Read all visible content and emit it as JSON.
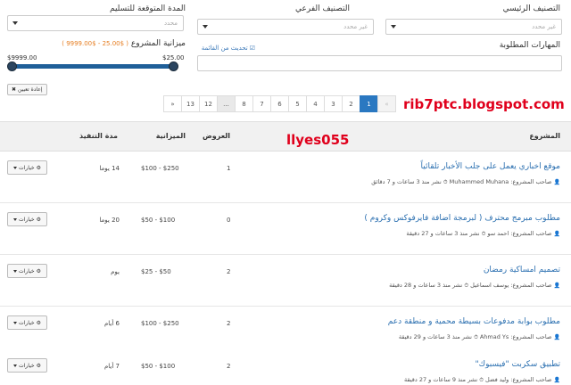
{
  "filters": {
    "main_category_label": "التصنيف الرئيسي",
    "main_category_value": "غير محدد",
    "sub_category_label": "التصنيف الفرعي",
    "sub_category_value": "غير محدد",
    "delivery_label": "المدة المتوقعة للتسليم",
    "delivery_value": "محدد",
    "skills_label": "المهارات المطلوبة",
    "update_list": "تحديث من القائمة",
    "budget_label": "ميزانية المشروع",
    "budget_range": "( $25.00 - $9999.00 )",
    "slider_min": "$25.00",
    "slider_max": "$9999.00",
    "reset": "إعادة تعيين"
  },
  "pagination": {
    "prev": "«",
    "pages": [
      "1",
      "2",
      "3",
      "4",
      "5",
      "6",
      "7",
      "8",
      "...",
      "12",
      "13"
    ],
    "next": "»",
    "active_page": 1
  },
  "watermarks": {
    "blog": "rib7ptc.blogspot.com",
    "user": "llyes055"
  },
  "table": {
    "headers": {
      "project": "المشروع",
      "bids": "العروض",
      "budget": "الميزانية",
      "duration": "مدة التنفيذ"
    },
    "option_label": "خيارات",
    "rows": [
      {
        "title": "موقع اخباري يعمل على جلب الأخبار تلقائياً",
        "owner": "صاحب المشروع: Muhammed Muhana",
        "posted": "نشر منذ 3 ساعات و 7 دقائق",
        "bids": "1",
        "budget": "$100 - $250",
        "duration": "14 يوما"
      },
      {
        "title": "مطلوب مبرمج محترف ( لبرمجة اضافة فايرفوكس وكروم )",
        "owner": "صاحب المشروع: احمد سو",
        "posted": "نشر منذ 3 ساعات و 27 دقيقة",
        "bids": "0",
        "budget": "$50 - $100",
        "duration": "20 يوما"
      },
      {
        "title": "تصميم امساكية رمضان",
        "owner": "صاحب المشروع: يوسف اسماعيل",
        "posted": "نشر منذ 3 ساعات و 28 دقيقة",
        "bids": "2",
        "budget": "$25 - $50",
        "duration": "يوم"
      },
      {
        "title": "مطلوب بوابة مدفوعات بسيطة محمية و منطقة دعم",
        "owner": "صاحب المشروع: Ahmad Ys",
        "posted": "نشر منذ 3 ساعات و 29 دقيقة",
        "bids": "2",
        "budget": "$100 - $250",
        "duration": "6 أيام"
      },
      {
        "title": "تطبيق سكربت \"فيسبوك\"",
        "owner": "صاحب المشروع: وليد فضل",
        "posted": "نشر منذ 9 ساعات و 27 دقيقة",
        "bids": "2",
        "budget": "$50 - $100",
        "duration": "7 أيام"
      }
    ]
  },
  "colors": {
    "accent": "#2a78c1",
    "slider": "#1f5f99",
    "budget_range": "#e67e22",
    "watermark": "#e0001c"
  }
}
